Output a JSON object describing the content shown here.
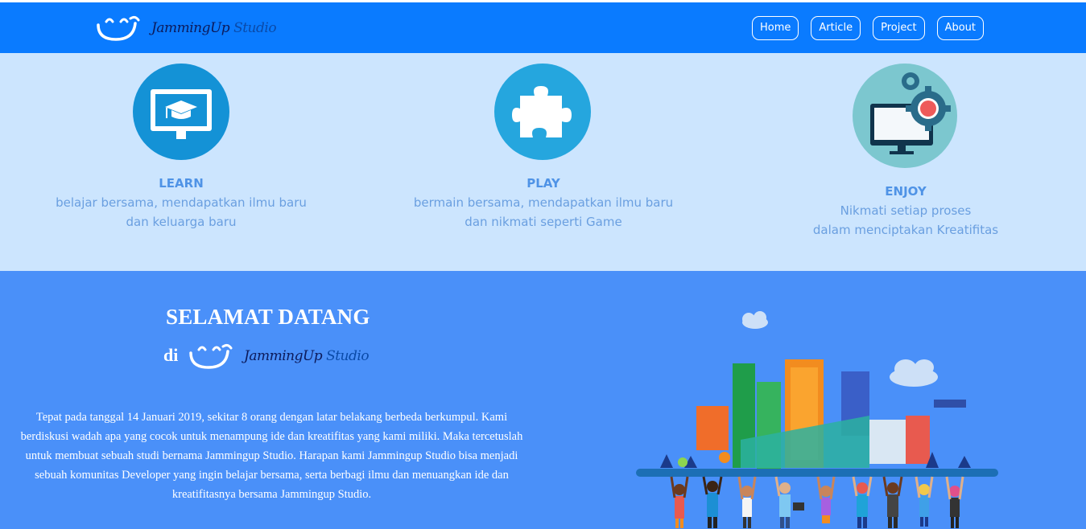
{
  "brand": {
    "word1": "JammingUp",
    "word2": "Studio"
  },
  "nav": {
    "items": [
      "Home",
      "Article",
      "Project",
      "About"
    ]
  },
  "features": [
    {
      "title": "LEARN",
      "line1": "belajar bersama, mendapatkan ilmu baru",
      "line2": "dan keluarga baru",
      "icon": "monitor-graduation-icon"
    },
    {
      "title": "PLAY",
      "line1": "bermain bersama, mendapatkan ilmu baru",
      "line2": "dan nikmati seperti Game",
      "icon": "puzzle-icon"
    },
    {
      "title": "ENJOY",
      "line1": "Nikmati setiap proses",
      "line2": "dalam menciptakan Kreatifitas",
      "icon": "monitor-gears-icon"
    }
  ],
  "welcome": {
    "title": "SELAMAT DATANG",
    "di": "di",
    "paragraph": "Tepat pada tanggal 14 Januari 2019, sekitar 8 orang dengan latar belakang berbeda berkumpul. Kami berdiskusi wadah apa yang cocok untuk menampung ide dan kreatifitas yang kami miliki. Maka tercetuslah untuk membuat sebuah studi bernama Jammingup Studio. Harapan kami Jammingup Studio bisa menjadi sebuah komunitas Developer yang ingin belajar bersama, serta berbagi ilmu dan menuangkan ide dan kreatifitasnya bersama Jammingup Studio."
  },
  "colors": {
    "navbar": "#0a7bff",
    "features_bg": "#cce5fe",
    "welcome_bg": "#4a90f9",
    "feature_text": "#6a9fe0"
  }
}
